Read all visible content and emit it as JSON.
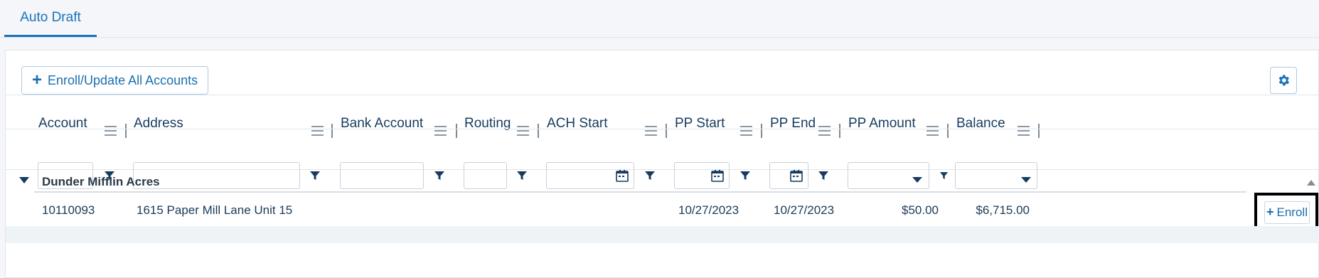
{
  "tabs": [
    {
      "label": "Auto Draft",
      "active": true
    }
  ],
  "toolbar": {
    "enroll_all_label": "Enroll/Update All Accounts",
    "enroll_all_icon": "plus-icon",
    "settings_icon": "gear-icon"
  },
  "columns": [
    {
      "key": "account",
      "label": "Account",
      "filter": "text"
    },
    {
      "key": "address",
      "label": "Address",
      "filter": "text"
    },
    {
      "key": "bank_account",
      "label": "Bank Account",
      "filter": "text"
    },
    {
      "key": "routing",
      "label": "Routing",
      "filter": "text"
    },
    {
      "key": "ach_start",
      "label": "ACH Start",
      "filter": "date"
    },
    {
      "key": "pp_start",
      "label": "PP Start",
      "filter": "date"
    },
    {
      "key": "pp_end",
      "label": "PP End",
      "filter": "date"
    },
    {
      "key": "pp_amount",
      "label": "PP Amount",
      "filter": "dropdown"
    },
    {
      "key": "balance",
      "label": "Balance",
      "filter": "dropdown"
    }
  ],
  "groups": [
    {
      "name": "Dunder Mifflin Acres",
      "rows": [
        {
          "account": "10110093",
          "address": "1615 Paper Mill Lane Unit 15",
          "bank_account": "",
          "routing": "",
          "ach_start": "",
          "pp_start": "10/27/2023",
          "pp_end": "10/27/2023",
          "pp_amount": "$50.00",
          "balance": "$6,715.00",
          "action_label": "Enroll"
        }
      ]
    }
  ],
  "colors": {
    "accent": "#1a73b8",
    "header_text": "#163b5f",
    "border": "#c9d1d9"
  }
}
